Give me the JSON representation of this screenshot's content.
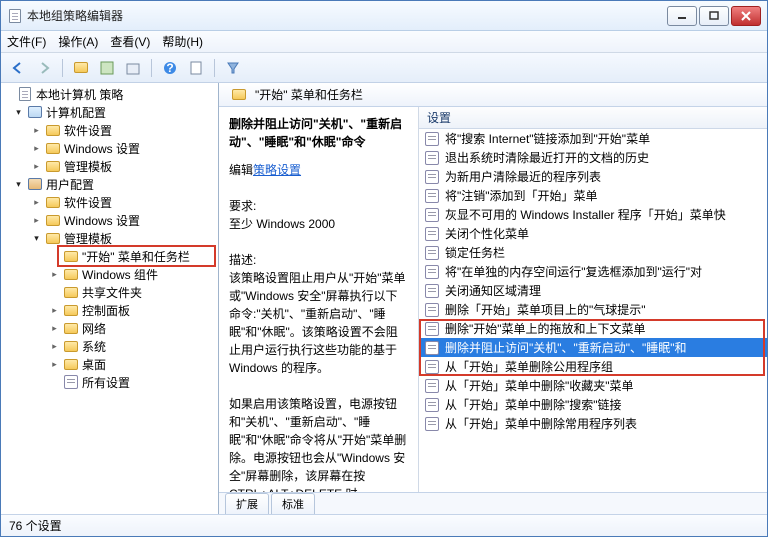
{
  "window": {
    "title": "本地组策略编辑器"
  },
  "menu": {
    "file": "文件(F)",
    "action": "操作(A)",
    "view": "查看(V)",
    "help": "帮助(H)"
  },
  "tree": {
    "root": "本地计算机 策略",
    "computer": "计算机配置",
    "c_software": "软件设置",
    "c_windows": "Windows 设置",
    "c_admin": "管理模板",
    "user": "用户配置",
    "u_software": "软件设置",
    "u_windows": "Windows 设置",
    "u_admin": "管理模板",
    "start_taskbar": "\"开始\" 菜单和任务栏",
    "win_components": "Windows 组件",
    "shared_folders": "共享文件夹",
    "control_panel": "控制面板",
    "network": "网络",
    "system": "系统",
    "desktop": "桌面",
    "all_settings": "所有设置"
  },
  "right_header": "\"开始\" 菜单和任务栏",
  "detail": {
    "heading": "删除并阻止访问\"关机\"、\"重新启动\"、\"睡眠\"和\"休眠\"命令",
    "edit_prefix": "编辑",
    "edit_link": "策略设置",
    "req_label": "要求:",
    "req_value": "至少 Windows 2000",
    "desc_label": "描述:",
    "desc_p1": "该策略设置阻止用户从\"开始\"菜单或\"Windows 安全\"屏幕执行以下命令:\"关机\"、\"重新启动\"、\"睡眠\"和\"休眠\"。该策略设置不会阻止用户运行执行这些功能的基于 Windows 的程序。",
    "desc_p2": "如果启用该策略设置，电源按钮和\"关机\"、\"重新启动\"、\"睡眠\"和\"休眠\"命令将从\"开始\"菜单删除。电源按钮也会从\"Windows 安全\"屏幕删除，该屏幕在按 CTRL+ALT+DELETE 时"
  },
  "list": {
    "header": "设置",
    "items": [
      "将\"搜索 Internet\"链接添加到\"开始\"菜单",
      "退出系统时清除最近打开的文档的历史",
      "为新用户清除最近的程序列表",
      "将\"注销\"添加到「开始」菜单",
      "灰显不可用的 Windows Installer 程序「开始」菜单快",
      "关闭个性化菜单",
      "锁定任务栏",
      "将\"在单独的内存空间运行\"复选框添加到\"运行\"对",
      "关闭通知区域清理",
      "删除「开始」菜单项目上的\"气球提示\"",
      "删除\"开始\"菜单上的拖放和上下文菜单",
      "删除并阻止访问\"关机\"、\"重新启动\"、\"睡眠\"和",
      "从「开始」菜单删除公用程序组",
      "从「开始」菜单中删除\"收藏夹\"菜单",
      "从「开始」菜单中删除\"搜索\"链接",
      "从「开始」菜单中删除常用程序列表"
    ],
    "selected_index": 11
  },
  "tabs": {
    "extended": "扩展",
    "standard": "标准"
  },
  "status": "76 个设置"
}
